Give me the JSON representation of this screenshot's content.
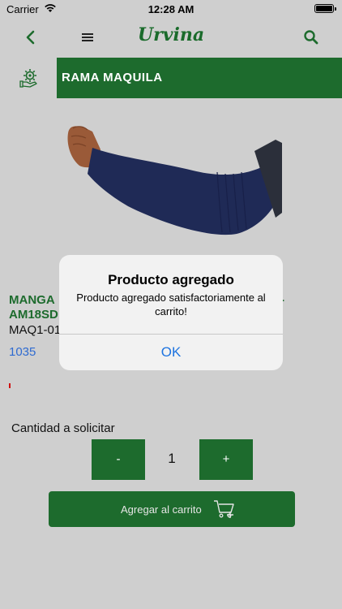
{
  "status_bar": {
    "carrier": "Carrier",
    "time": "12:28 AM"
  },
  "nav": {
    "brand": "Urvina",
    "icons": [
      "back-chevron-icon",
      "menu-icon",
      "search-icon"
    ]
  },
  "category": {
    "title": "RAMA MAQUILA",
    "icon": "gear-hand-icon"
  },
  "product": {
    "name_line1": "MANGA",
    "name_line2": "AM18SD",
    "name_trailing": "-",
    "code": "MAQ1-01",
    "stock": "1035"
  },
  "quantity": {
    "label": "Cantidad a solicitar",
    "minus_label": "-",
    "value": "1",
    "plus_label": "+"
  },
  "add_to_cart": {
    "label": "Agregar al carrito",
    "icon": "cart-add-icon"
  },
  "alert": {
    "title": "Producto agregado",
    "message": "Producto agregado satisfactoriamente al carrito!",
    "ok_label": "OK"
  },
  "colors": {
    "brand_green": "#1d6b2d",
    "link_blue": "#2f6bd1",
    "background": "#cfcfcf"
  }
}
